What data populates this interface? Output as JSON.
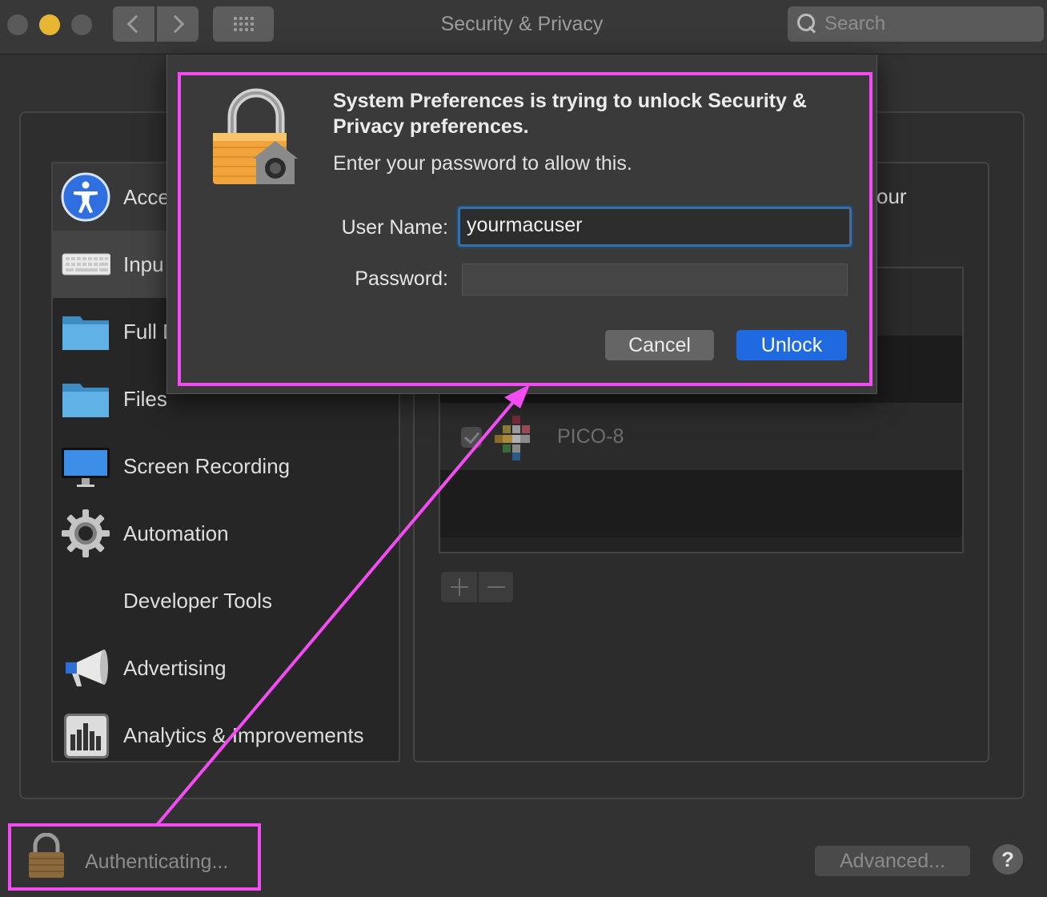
{
  "window": {
    "title": "Security & Privacy",
    "search_placeholder": "Search"
  },
  "sidebar": {
    "items": [
      {
        "label": "Accessibility",
        "visible_label": "Acce",
        "icon": "accessibility-icon"
      },
      {
        "label": "Input Monitoring",
        "visible_label": "Inpu",
        "icon": "keyboard-icon"
      },
      {
        "label": "Full Disk Access",
        "visible_label": "Full D",
        "icon": "folder-icon"
      },
      {
        "label": "Files and Folders",
        "visible_label": "Files",
        "icon": "folder-icon"
      },
      {
        "label": "Screen Recording",
        "icon": "display-icon"
      },
      {
        "label": "Automation",
        "icon": "gear-icon"
      },
      {
        "label": "Developer Tools",
        "icon": ""
      },
      {
        "label": "Advertising",
        "icon": "megaphone-icon"
      },
      {
        "label": "Analytics & Improvements",
        "icon": "bar-chart-icon"
      }
    ]
  },
  "main": {
    "header_fragment": "our",
    "apps": [
      {
        "name": "PICO-8",
        "checked": true
      }
    ]
  },
  "bottom": {
    "lock_status": "Authenticating...",
    "advanced_label": "Advanced...",
    "help_label": "?"
  },
  "dialog": {
    "title": "System Preferences is trying to unlock Security & Privacy preferences.",
    "subtitle": "Enter your password to allow this.",
    "username_label": "User Name:",
    "username_value": "yourmacuser",
    "password_label": "Password:",
    "cancel_label": "Cancel",
    "unlock_label": "Unlock"
  },
  "colors": {
    "annotation": "#f24cf2",
    "accent": "#1f6ae0",
    "focus_ring": "#3a6fa2"
  }
}
